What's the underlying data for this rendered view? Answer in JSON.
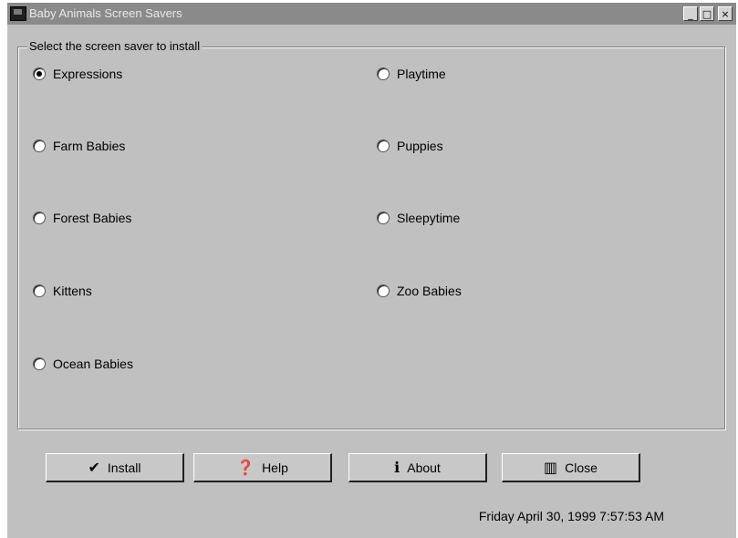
{
  "window": {
    "title": "Baby Animals Screen Savers",
    "controls": {
      "minimize": "_",
      "maximize": "□",
      "close": "×"
    }
  },
  "group": {
    "legend": "Select the screen saver to install",
    "options": [
      {
        "label": "Expressions",
        "checked": true
      },
      {
        "label": "Playtime",
        "checked": false
      },
      {
        "label": "Farm Babies",
        "checked": false
      },
      {
        "label": "Puppies",
        "checked": false
      },
      {
        "label": "Forest Babies",
        "checked": false
      },
      {
        "label": "Sleepytime",
        "checked": false
      },
      {
        "label": "Kittens",
        "checked": false
      },
      {
        "label": "Zoo Babies",
        "checked": false
      },
      {
        "label": "Ocean Babies",
        "checked": false
      }
    ]
  },
  "buttons": {
    "install": {
      "label": "Install",
      "icon": "checkmark-icon"
    },
    "help": {
      "label": "Help",
      "icon": "question-icon"
    },
    "about": {
      "label": "About",
      "icon": "info-icon"
    },
    "close": {
      "label": "Close",
      "icon": "door-icon"
    }
  },
  "status": {
    "datetime": "Friday April 30, 1999 7:57:53 AM"
  }
}
